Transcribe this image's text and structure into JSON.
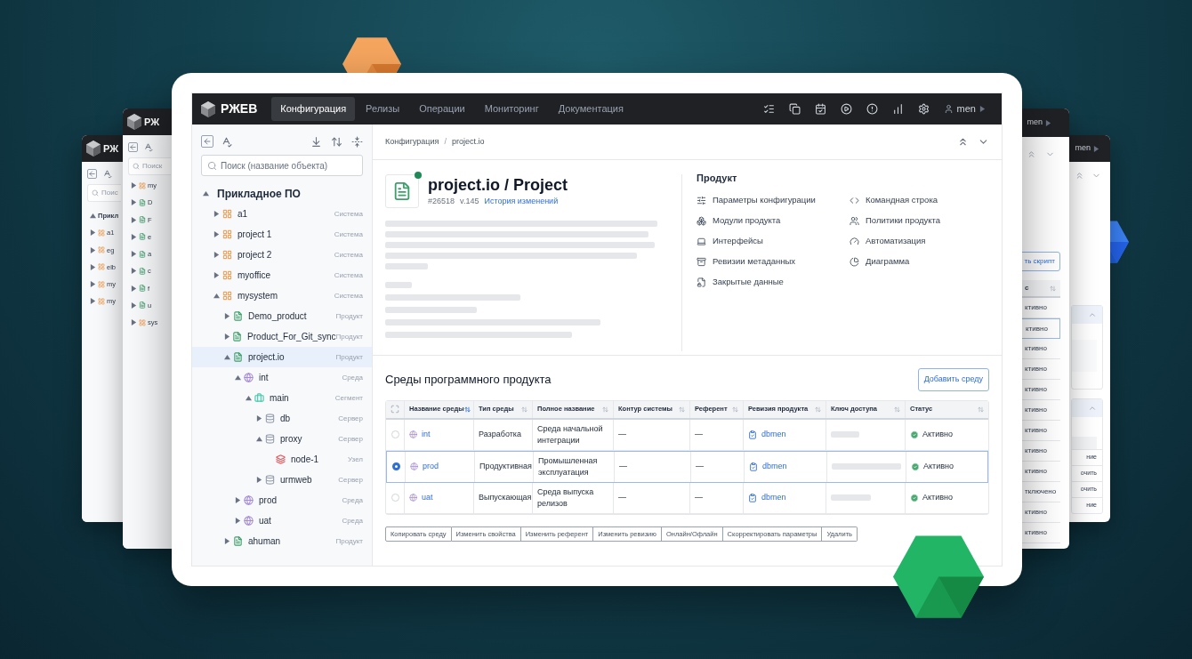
{
  "background_windows": {
    "left": [
      {
        "logo": "РЖ",
        "search_placeholder": "Поис",
        "rows": [
          {
            "label": "Прикл",
            "kind": "root"
          },
          {
            "label": "a1",
            "kind": "system"
          },
          {
            "label": "eg",
            "kind": "system"
          },
          {
            "label": "elb",
            "kind": "system"
          },
          {
            "label": "my",
            "kind": "system"
          },
          {
            "label": "my",
            "kind": "system"
          }
        ]
      },
      {
        "logo": "РЖ",
        "search_placeholder": "Поиск",
        "rows": [
          {
            "label": "my",
            "kind": "system"
          },
          {
            "label": "D",
            "kind": "product"
          },
          {
            "label": "F",
            "kind": "product"
          },
          {
            "label": "e",
            "kind": "product"
          },
          {
            "label": "a",
            "kind": "product"
          },
          {
            "label": "c",
            "kind": "product"
          },
          {
            "label": "f",
            "kind": "product"
          },
          {
            "label": "u",
            "kind": "product"
          },
          {
            "label": "sys",
            "kind": "system"
          }
        ]
      }
    ],
    "right": [
      {
        "user": "men",
        "button": "ть скрипт",
        "column": "с",
        "statuses": [
          "ктивно",
          "ктивно",
          "ктивно",
          "ктивно",
          "ктивно",
          "ктивно",
          "ктивно",
          "ктивно",
          "ктивно",
          "тключено",
          "ктивно",
          "ктивно"
        ]
      },
      {
        "user": "men",
        "cells": [
          "ние",
          "очить",
          "очить",
          "ние"
        ]
      }
    ]
  },
  "header": {
    "logo": "РЖЕВ",
    "nav": [
      {
        "label": "Конфигурация",
        "selected": true
      },
      {
        "label": "Релизы",
        "selected": false
      },
      {
        "label": "Операции",
        "selected": false
      },
      {
        "label": "Мониторинг",
        "selected": false
      },
      {
        "label": "Документация",
        "selected": false
      }
    ],
    "user": "men"
  },
  "sidebar": {
    "search_placeholder": "Поиск (название объекта)",
    "tree": [
      {
        "label": "Прикладное ПО",
        "expanded": true,
        "selected": false,
        "children": [
          {
            "label": "a1",
            "type": "Система",
            "kind": "system",
            "expanded": false,
            "selected": false
          },
          {
            "label": "project 1",
            "type": "Система",
            "kind": "system",
            "expanded": false,
            "selected": false
          },
          {
            "label": "project 2",
            "type": "Система",
            "kind": "system",
            "expanded": false,
            "selected": false
          },
          {
            "label": "myoffice",
            "type": "Система",
            "kind": "system",
            "expanded": false,
            "selected": false
          },
          {
            "label": "mysystem",
            "type": "Система",
            "kind": "system",
            "expanded": true,
            "selected": false,
            "children": [
              {
                "label": "Demo_product",
                "type": "Продукт",
                "kind": "product",
                "expanded": false,
                "selected": false
              },
              {
                "label": "Product_For_Git_sync",
                "type": "Продукт",
                "kind": "product",
                "expanded": false,
                "selected": false
              },
              {
                "label": "project.io",
                "type": "Продукт",
                "kind": "product",
                "expanded": true,
                "selected": true,
                "children": [
                  {
                    "label": "int",
                    "type": "Среда",
                    "kind": "env",
                    "expanded": true,
                    "selected": false,
                    "children": [
                      {
                        "label": "main",
                        "type": "Сегмент",
                        "kind": "segment",
                        "expanded": true,
                        "selected": false,
                        "children": [
                          {
                            "label": "db",
                            "type": "Сервер",
                            "kind": "server",
                            "expanded": false,
                            "selected": false
                          },
                          {
                            "label": "proxy",
                            "type": "Сервер",
                            "kind": "server",
                            "expanded": true,
                            "selected": false,
                            "children": [
                              {
                                "label": "node-1",
                                "type": "Узел",
                                "kind": "node",
                                "selected": false
                              }
                            ]
                          },
                          {
                            "label": "urmweb",
                            "type": "Сервер",
                            "kind": "server",
                            "expanded": false,
                            "selected": false
                          }
                        ]
                      }
                    ]
                  },
                  {
                    "label": "prod",
                    "type": "Среда",
                    "kind": "env",
                    "expanded": false,
                    "selected": false
                  },
                  {
                    "label": "uat",
                    "type": "Среда",
                    "kind": "env",
                    "expanded": false,
                    "selected": false
                  }
                ]
              },
              {
                "label": "ahuman",
                "type": "Продукт",
                "kind": "product",
                "expanded": false,
                "selected": false
              }
            ]
          }
        ]
      }
    ]
  },
  "breadcrumb": {
    "items": [
      "Конфигурация",
      "project.io"
    ],
    "separator": "/"
  },
  "object": {
    "title": "project.io / Project",
    "online": true,
    "id": "#26518",
    "version": "v.145",
    "history_link": "История изменений"
  },
  "product": {
    "heading": "Продукт",
    "links": [
      {
        "label": "Параметры конфигурации",
        "kind": "sliders"
      },
      {
        "label": "Командная строка",
        "kind": "code"
      },
      {
        "label": "Модули продукта",
        "kind": "modules"
      },
      {
        "label": "Политики продукта",
        "kind": "users"
      },
      {
        "label": "Интерфейсы",
        "kind": "laptop"
      },
      {
        "label": "Автоматизация",
        "kind": "gauge"
      },
      {
        "label": "Ревизии метаданных",
        "kind": "archive"
      },
      {
        "label": "Диаграмма",
        "kind": "pie"
      },
      {
        "label": "Закрытые данные",
        "kind": "lock"
      }
    ]
  },
  "environments": {
    "title": "Среды программного продукта",
    "add_button": "Добавить среду",
    "columns": [
      {
        "label": "Название среды",
        "sorted": true
      },
      {
        "label": "Тип среды",
        "sorted": false
      },
      {
        "label": "Полное название",
        "sorted": false
      },
      {
        "label": "Контур системы",
        "sorted": false
      },
      {
        "label": "Референт",
        "sorted": false
      },
      {
        "label": "Ревизия продукта",
        "sorted": false
      },
      {
        "label": "Ключ доступа",
        "sorted": false
      },
      {
        "label": "Статус",
        "sorted": false
      }
    ],
    "rows": [
      {
        "selected": false,
        "name": "int",
        "type": "Разработка",
        "full_name": "Среда начальной интеграции",
        "contour": "—",
        "referent": "—",
        "revision": "dbmen",
        "status": "Активно"
      },
      {
        "selected": true,
        "name": "prod",
        "type": "Продуктивная",
        "full_name": "Промышленная эксплуатация",
        "contour": "—",
        "referent": "—",
        "revision": "dbmen",
        "status": "Активно"
      },
      {
        "selected": false,
        "name": "uat",
        "type": "Выпускающая",
        "full_name": "Среда выпуска релизов",
        "contour": "—",
        "referent": "—",
        "revision": "dbmen",
        "status": "Активно"
      }
    ],
    "actions": [
      "Копировать среду",
      "Изменить свойства",
      "Изменить референт",
      "Изменить ревизию",
      "Онлайн/Офлайн",
      "Скорректировать параметры",
      "Удалить"
    ]
  }
}
